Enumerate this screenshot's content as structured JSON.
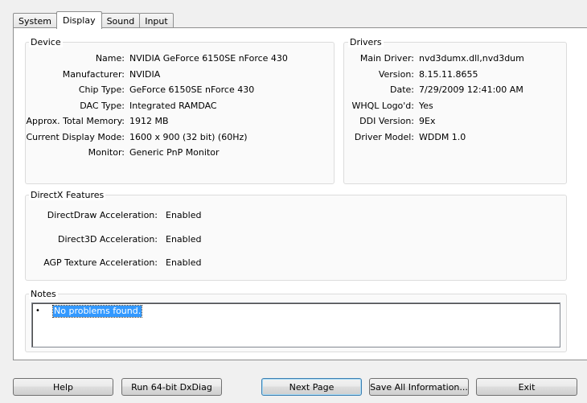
{
  "tabs": [
    "System",
    "Display",
    "Sound",
    "Input"
  ],
  "device": {
    "title": "Device",
    "rows": [
      {
        "label": "Name:",
        "value": "NVIDIA GeForce 6150SE nForce 430"
      },
      {
        "label": "Manufacturer:",
        "value": "NVIDIA"
      },
      {
        "label": "Chip Type:",
        "value": "GeForce 6150SE nForce 430"
      },
      {
        "label": "DAC Type:",
        "value": "Integrated RAMDAC"
      },
      {
        "label": "Approx. Total Memory:",
        "value": "1912 MB"
      },
      {
        "label": "Current Display Mode:",
        "value": "1600 x 900 (32 bit) (60Hz)"
      },
      {
        "label": "Monitor:",
        "value": "Generic PnP Monitor"
      }
    ]
  },
  "drivers": {
    "title": "Drivers",
    "rows": [
      {
        "label": "Main Driver:",
        "value": "nvd3dumx.dll,nvd3dum"
      },
      {
        "label": "Version:",
        "value": "8.15.11.8655"
      },
      {
        "label": "Date:",
        "value": "7/29/2009 12:41:00 AM"
      },
      {
        "label": "WHQL Logo'd:",
        "value": "Yes"
      },
      {
        "label": "DDI Version:",
        "value": "9Ex"
      },
      {
        "label": "Driver Model:",
        "value": "WDDM 1.0"
      }
    ]
  },
  "directx": {
    "title": "DirectX Features",
    "rows": [
      {
        "label": "DirectDraw Acceleration:",
        "value": "Enabled"
      },
      {
        "label": "Direct3D Acceleration:",
        "value": "Enabled"
      },
      {
        "label": "AGP Texture Acceleration:",
        "value": "Enabled"
      }
    ]
  },
  "notes": {
    "title": "Notes",
    "bullet": "•",
    "text": "No problems found."
  },
  "buttons": {
    "help": "Help",
    "run64": "Run 64-bit DxDiag",
    "next": "Next Page",
    "save": "Save All Information...",
    "exit": "Exit"
  }
}
